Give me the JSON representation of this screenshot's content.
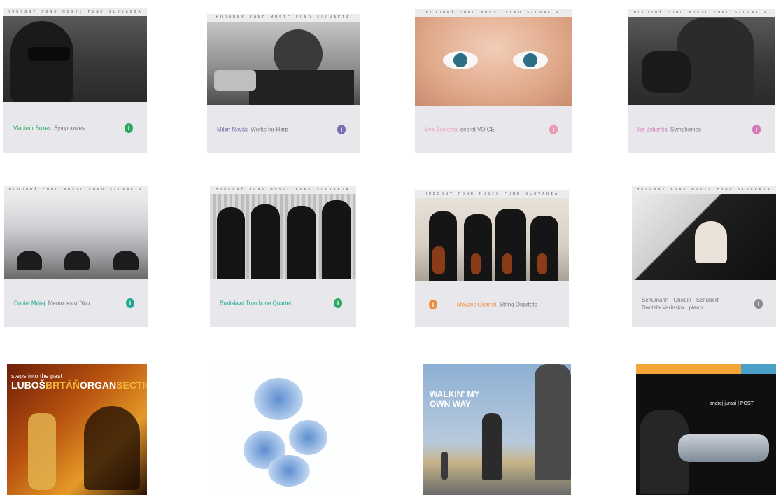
{
  "covers": [
    {
      "series": "HUDOBNÝ FOND MUSIC FUND SLOVAKIA",
      "name": "Vladimír Bokes",
      "title": "Symphonies",
      "badge_color": "#2aa864",
      "name_color": "#2aa864"
    },
    {
      "series": "HUDOBNÝ FOND MUSIC FUND SLOVAKIA",
      "name": "Milan Novák",
      "title": "Works for Harp",
      "badge_color": "#7c6bb0",
      "name_color": "#7c6bb0"
    },
    {
      "series": "HUDOBNÝ FOND MUSIC FUND SLOVAKIA",
      "name": "Eva Šušková",
      "title": "secret VOICE",
      "badge_color": "#e99ab2",
      "name_color": "#e99ab2"
    },
    {
      "series": "HUDOBNÝ FOND MUSIC FUND SLOVAKIA",
      "name": "Ilja Zeljenka",
      "title": "Symphonies",
      "badge_color": "#d475b5",
      "name_color": "#d475b5"
    },
    {
      "series": "HUDOBNÝ FOND MUSIC FUND SLOVAKIA",
      "name": "Daniel Matej",
      "title": "Memories of You",
      "badge_color": "#1ba88f",
      "name_color": "#1ba88f"
    },
    {
      "series": "HUDOBNÝ FOND MUSIC FUND SLOVAKIA",
      "name": "Bratislava Trombone Quartet",
      "title": "",
      "badge_color": "#2aa864",
      "name_color": "#1ba88f"
    },
    {
      "series": "HUDOBNÝ FOND MUSIC FUND SLOVAKIA",
      "name": "Moyzes Quartet",
      "title": "String Quartets",
      "badge_color": "#f08a3c",
      "name_color": "#f08a3c"
    },
    {
      "series": "HUDOBNÝ FOND MUSIC FUND SLOVAKIA",
      "name": "Schumann · Chopin · Schubert",
      "title": "Daniela Varínska · piano",
      "badge_color": "#8a8a8a",
      "name_color": "#666666"
    }
  ],
  "covers_bottom": [
    {
      "line1": "steps into the past",
      "line2a": "LUBOŠ",
      "line2b": "BRTÁŇ",
      "line2c": "ORGAN",
      "line2d": "SECTION"
    },
    {
      "line1": ""
    },
    {
      "line1": "WALKIN' MY",
      "line2": "OWN WAY"
    },
    {
      "line1": "andrej jurasi | POST"
    }
  ]
}
